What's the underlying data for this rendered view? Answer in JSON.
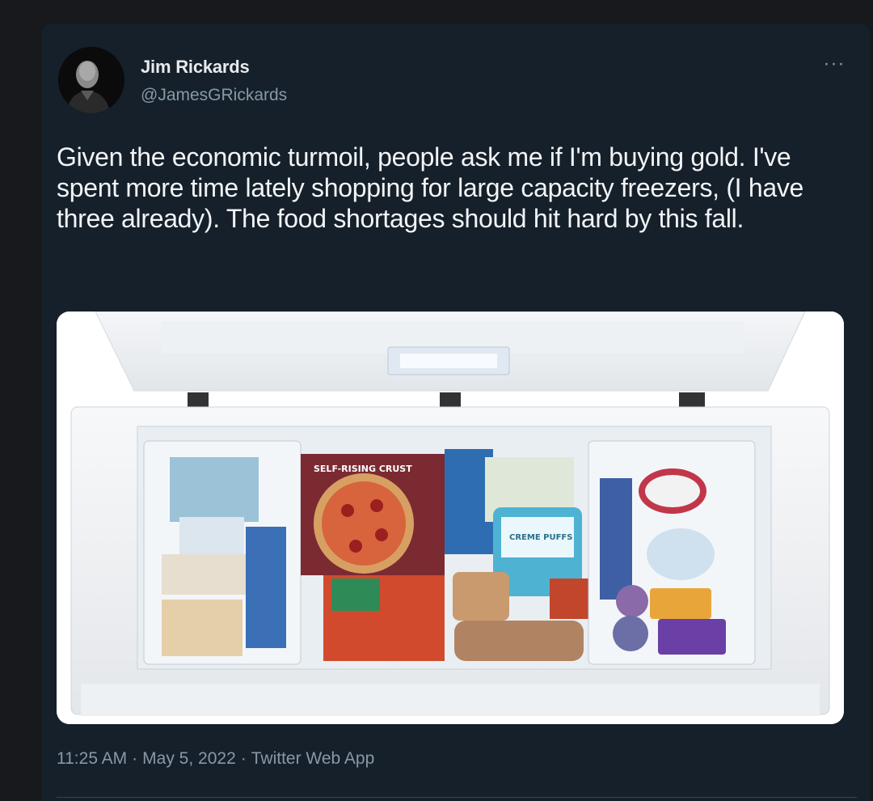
{
  "tweet": {
    "author": {
      "display_name": "Jim Rickards",
      "handle": "@JamesGRickards"
    },
    "more_icon": "more-dots-icon",
    "text": "Given the economic turmoil, people ask me if I'm buying gold. I've spent more time lately shopping for large capacity freezers, (I have three already). The food shortages should hit hard by this fall.",
    "media": {
      "pizza_box_label": "SELF-RISING CRUST",
      "tub_label": "CREME PUFFS"
    },
    "meta": {
      "time": "11:25 AM",
      "date": "May 5, 2022",
      "source": "Twitter Web App",
      "separator": "·"
    }
  },
  "colors": {
    "page_background": "#17191c",
    "card_background": "#15202b",
    "text_primary": "#f2f4f6",
    "text_secondary": "#8899a6"
  }
}
